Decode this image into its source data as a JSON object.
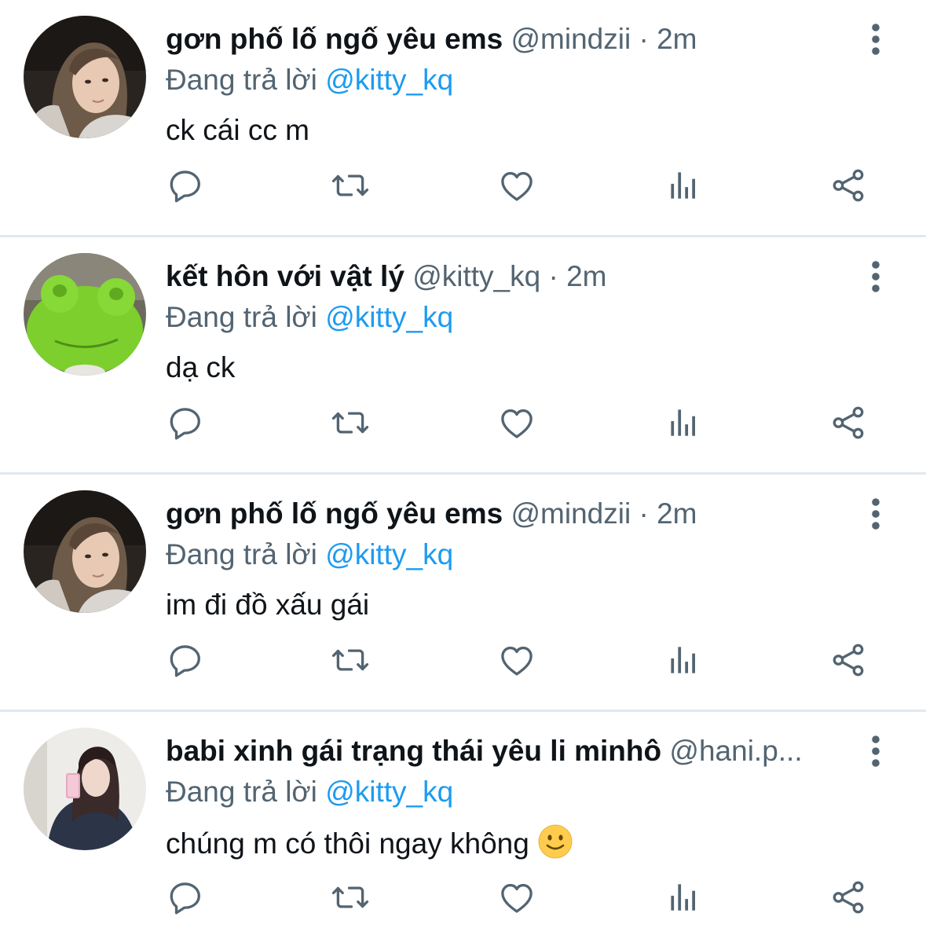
{
  "colors": {
    "text": "#0f1419",
    "secondary": "#536471",
    "link": "#1d9bf0",
    "divider": "#e1e8ed"
  },
  "icons": {
    "reply": "comment-bubble-icon",
    "retweet": "retweet-icon",
    "like": "heart-icon",
    "views": "bar-chart-icon",
    "share": "share-icon",
    "more": "vertical-dots-icon"
  },
  "tweets": [
    {
      "display_name": "gơn phố lố ngố yêu ems",
      "handle": "@mindzii",
      "separator": "·",
      "time": "2m",
      "reply_prefix": "Đang trả lời",
      "reply_to": "@kitty_kq",
      "text": "ck cái cc m",
      "avatar": "girl-selfie-avatar"
    },
    {
      "display_name": "kết hôn với vật lý",
      "handle": "@kitty_kq",
      "separator": "·",
      "time": "2m",
      "reply_prefix": "Đang trả lời",
      "reply_to": "@kitty_kq",
      "text": "dạ ck",
      "avatar": "green-frog-plush-avatar"
    },
    {
      "display_name": "gơn phố lố ngố yêu ems",
      "handle": "@mindzii",
      "separator": "·",
      "time": "2m",
      "reply_prefix": "Đang trả lời",
      "reply_to": "@kitty_kq",
      "text": "im đi đồ xấu gái",
      "avatar": "girl-selfie-avatar"
    },
    {
      "display_name": "babi xinh gái trạng thái yêu li minhô",
      "handle": "@hani.p...",
      "separator": "",
      "time": "",
      "reply_prefix": "Đang trả lời",
      "reply_to": "@kitty_kq",
      "text": "chúng m có thôi ngay không",
      "emoji": "slightly-smiling-face-emoji",
      "avatar": "mirror-selfie-avatar"
    }
  ]
}
